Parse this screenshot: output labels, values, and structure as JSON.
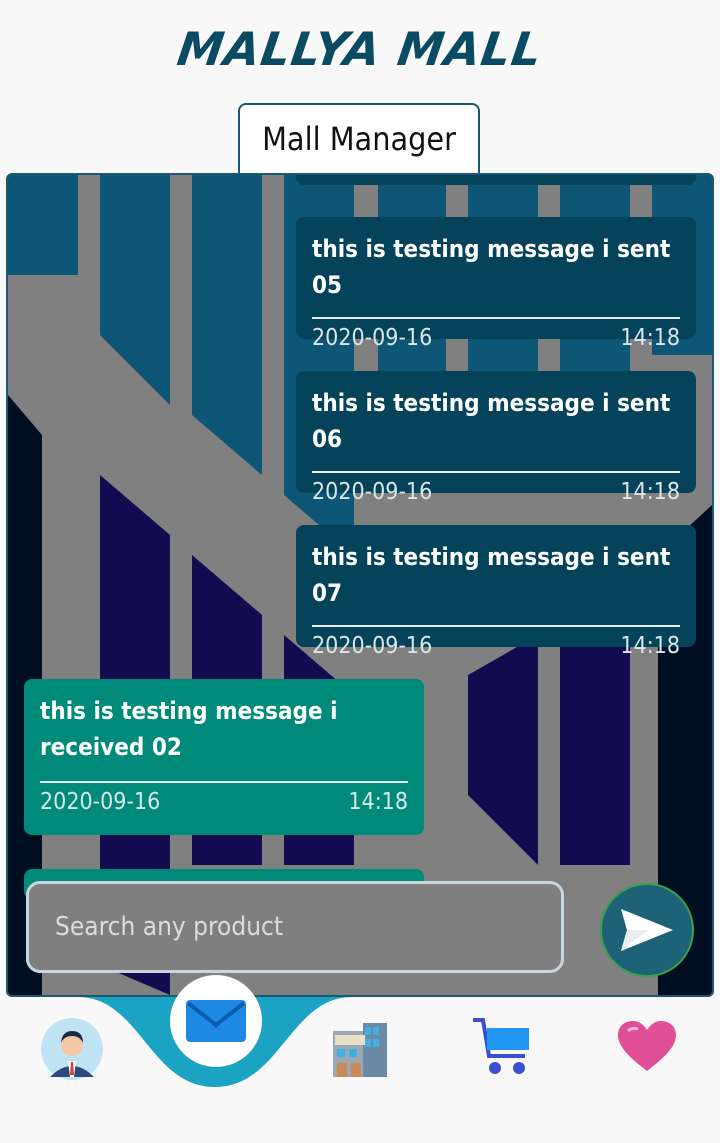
{
  "header": {
    "brand": "MALLYA MALL",
    "tab_label": "Mall Manager"
  },
  "messages": [
    {
      "type": "sent",
      "text": "this is testing message i sent 05",
      "date": "2020-09-16",
      "time": "14:18"
    },
    {
      "type": "sent",
      "text": "this is testing message i sent 06",
      "date": "2020-09-16",
      "time": "14:18"
    },
    {
      "type": "sent",
      "text": "this is testing message i sent 07",
      "date": "2020-09-16",
      "time": "14:18"
    },
    {
      "type": "received",
      "text": "this is testing message i received 02",
      "date": "2020-09-16",
      "time": "14:18"
    }
  ],
  "composer": {
    "placeholder": "Search any product",
    "send_icon": "send-icon"
  },
  "bottom_nav": [
    {
      "name": "profile",
      "icon": "manager-avatar-icon"
    },
    {
      "name": "messages",
      "icon": "mail-icon",
      "active": true
    },
    {
      "name": "mall",
      "icon": "mall-building-icon"
    },
    {
      "name": "cart",
      "icon": "shopping-cart-icon"
    },
    {
      "name": "favorites",
      "icon": "heart-icon"
    }
  ],
  "colors": {
    "brand": "#0a4a63",
    "sent_bubble": "#04435a",
    "received_bubble": "#008a7a",
    "nav_accent": "#1aa3c2"
  }
}
